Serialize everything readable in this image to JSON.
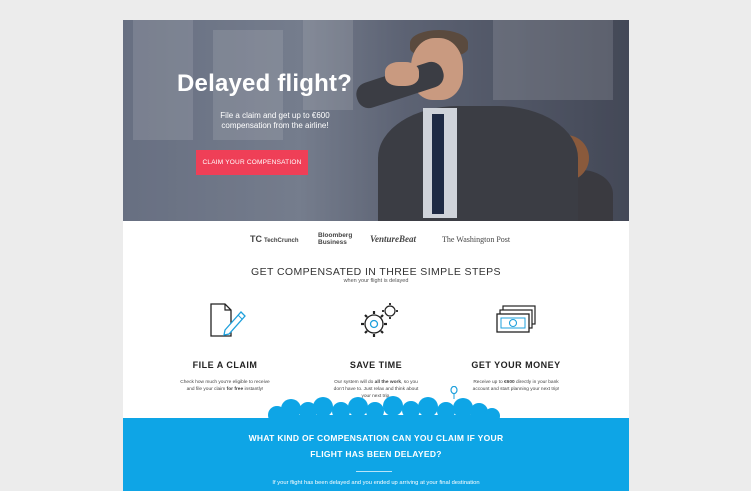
{
  "hero": {
    "title": "Delayed flight?",
    "subtitle_line1": "File a claim and get up to €600",
    "subtitle_line2": "compensation from the airline!",
    "cta_label": "CLAIM YOUR COMPENSATION"
  },
  "press": {
    "techcrunch": "TechCrunch",
    "techcrunch_mark": "TC",
    "bloomberg_line1": "Bloomberg",
    "bloomberg_line2": "Business",
    "venturebeat": "VentureBeat",
    "washington_post": "The Washington Post"
  },
  "steps": {
    "title": "GET COMPENSATED IN THREE SIMPLE STEPS",
    "subtitle": "when your flight is delayed",
    "items": [
      {
        "name": "FILE A CLAIM",
        "desc_a": "Check how much you're eligible to receive",
        "desc_b": "and file your claim ",
        "desc_bold": "for free",
        "desc_c": " instantly!"
      },
      {
        "name": "SAVE TIME",
        "desc_a": "Our system will do ",
        "desc_bold": "all the work",
        "desc_b": ", so you",
        "desc_c": "don't have to. Just relax and think about",
        "desc_d": "your next trip."
      },
      {
        "name": "GET YOUR MONEY",
        "desc_a": "Receive up to ",
        "desc_bold": "€600",
        "desc_b": " directly in your bank",
        "desc_c": "account and start planning your next trip!"
      }
    ]
  },
  "info": {
    "title_line1": "WHAT KIND OF COMPENSATION CAN YOU CLAIM IF YOUR",
    "title_line2": "FLIGHT HAS BEEN DELAYED?",
    "text": "If your flight has been delayed and you ended up arriving at your final destination"
  },
  "colors": {
    "accent": "#ef3f57",
    "blue": "#0ea5e6",
    "icon_blue": "#1ea0dc"
  }
}
